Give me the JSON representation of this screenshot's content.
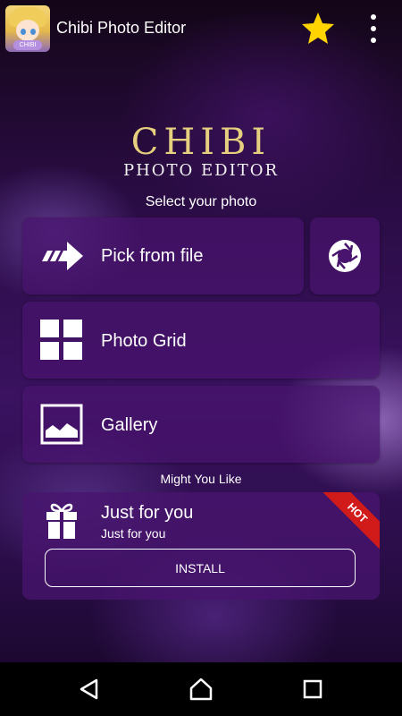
{
  "toolbar": {
    "app_title": "Chibi Photo Editor",
    "app_icon_tag": "CHIBI",
    "star_icon": "star-icon",
    "menu_icon": "more-vert-icon"
  },
  "logo": {
    "title": "CHIBI",
    "subtitle": "PHOTO EDITOR"
  },
  "select_section": {
    "label": "Select your photo"
  },
  "options": [
    {
      "label": "Pick from file",
      "icon": "arrow-right-icon"
    },
    {
      "label": "Photo Grid",
      "icon": "grid-icon"
    },
    {
      "label": "Gallery",
      "icon": "image-icon"
    }
  ],
  "camera_button": {
    "icon": "camera-shutter-icon"
  },
  "promo_section": {
    "label": "Might You Like",
    "title": "Just for you",
    "subtitle": "Just for you",
    "install_label": "INSTALL",
    "badge": "HOT",
    "icon": "gift-icon"
  },
  "navbar": {
    "back_icon": "back-icon",
    "home_icon": "home-icon",
    "recents_icon": "recents-icon"
  },
  "colors": {
    "accent_gold": "#e6cf7e",
    "card": "#48146e",
    "hot_red": "#d11a1a"
  }
}
